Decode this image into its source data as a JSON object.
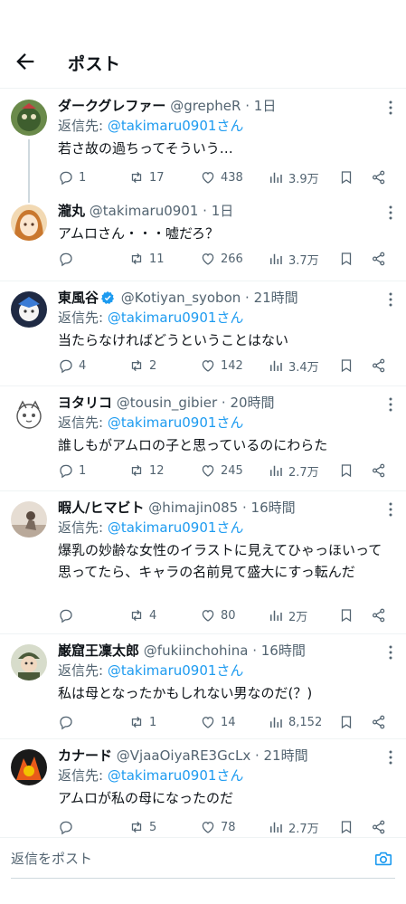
{
  "header": {
    "title": "ポスト"
  },
  "tweets": [
    {
      "name": "ダークグレファー",
      "handle": "@grepheR",
      "time": "1日",
      "reply_label": "返信先:",
      "reply_to": "@takimaru0901さん",
      "text": "若さ故の過ちってそういう…",
      "replies": "1",
      "reposts": "17",
      "likes": "438",
      "views": "3.9万",
      "verified": false
    },
    {
      "name": "瀧丸",
      "handle": "@takimaru0901",
      "time": "1日",
      "text": "アムロさん・・・嘘だろ？",
      "replies": "",
      "reposts": "11",
      "likes": "266",
      "views": "3.7万",
      "verified": false
    },
    {
      "name": "東風谷",
      "handle": "@Kotiyan_syobon",
      "time": "21時間",
      "reply_label": "返信先:",
      "reply_to": "@takimaru0901さん",
      "text": "当たらなければどうということはない",
      "replies": "4",
      "reposts": "2",
      "likes": "142",
      "views": "3.4万",
      "verified": true
    },
    {
      "name": "ヨタリコ",
      "handle": "@tousin_gibier",
      "time": "20時間",
      "reply_label": "返信先:",
      "reply_to": "@takimaru0901さん",
      "text": "誰しもがアムロの子と思っているのにわらた",
      "replies": "1",
      "reposts": "12",
      "likes": "245",
      "views": "2.7万",
      "verified": false
    },
    {
      "name": "暇人/ヒマビト",
      "handle": "@himajin085",
      "time": "16時間",
      "reply_label": "返信先:",
      "reply_to": "@takimaru0901さん",
      "text": "爆乳の妙齢な女性のイラストに見えてひゃっほいって思ってたら、キャラの名前見て盛大にすっ転んだ",
      "replies": "",
      "reposts": "4",
      "likes": "80",
      "views": "2万",
      "verified": false
    },
    {
      "name": "巌窟王凜太郎",
      "handle": "@fukiinchohina",
      "time": "16時間",
      "reply_label": "返信先:",
      "reply_to": "@takimaru0901さん",
      "text": "私は母となったかもしれない男なのだ(？)",
      "replies": "",
      "reposts": "1",
      "likes": "14",
      "views": "8,152",
      "verified": false
    },
    {
      "name": "カナード",
      "handle": "@VjaaOiyaRE3GcLx",
      "time": "21時間",
      "reply_label": "返信先:",
      "reply_to": "@takimaru0901さん",
      "text": "アムロが私の母になったのだ",
      "replies": "",
      "reposts": "5",
      "likes": "78",
      "views": "2.7万",
      "verified": false
    }
  ],
  "reply_bar": {
    "placeholder": "返信をポスト"
  },
  "colors": {
    "accent": "#1d9bf0",
    "text": "#0f1419",
    "muted": "#536471",
    "divider": "#eff3f4"
  }
}
